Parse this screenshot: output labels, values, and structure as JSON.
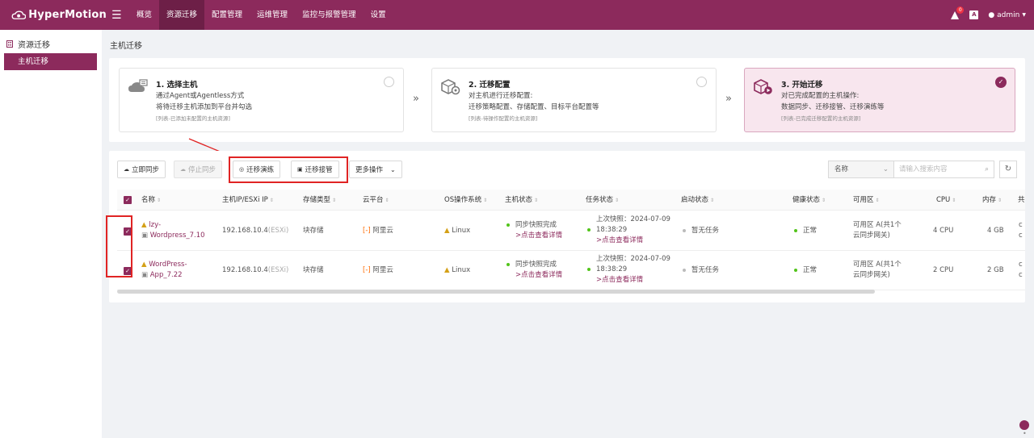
{
  "header": {
    "brand": "HyperMotion",
    "nav": [
      {
        "label": "概览"
      },
      {
        "label": "资源迁移"
      },
      {
        "label": "配置管理"
      },
      {
        "label": "运维管理"
      },
      {
        "label": "监控与报警管理"
      },
      {
        "label": "设置"
      }
    ],
    "active_nav": "资源迁移",
    "notification_count": "0",
    "lang_badge": "A",
    "user": "admin"
  },
  "sidebar": {
    "group_label": "资源迁移",
    "items": [
      {
        "label": "主机迁移"
      }
    ]
  },
  "page_title": "主机迁移",
  "steps": [
    {
      "title": "1. 选择主机",
      "desc1": "通过Agent或Agentless方式",
      "desc2": "将待迁移主机添加到平台并勾选",
      "note": "[列表-已添加未配置的主机资源]",
      "state": "pending"
    },
    {
      "title": "2. 迁移配置",
      "desc1": "对主机进行迁移配置:",
      "desc2": "迁移策略配置、存储配置、目标平台配置等",
      "note": "[列表-待操作配置的主机资源]",
      "state": "pending"
    },
    {
      "title": "3. 开始迁移",
      "desc1": "对已完成配置的主机操作:",
      "desc2": "数据同步、迁移接管、迁移演练等",
      "note": "[列表-已完成迁移配置的主机资源]",
      "state": "active"
    }
  ],
  "toolbar": {
    "sync_now": "立即同步",
    "stop_sync": "停止同步",
    "drill": "迁移演练",
    "takeover": "迁移接管",
    "more": "更多操作",
    "search_field": "名称",
    "search_placeholder": "请输入搜索内容"
  },
  "table": {
    "columns": [
      "名称",
      "主机IP/ESXi IP",
      "存储类型",
      "云平台",
      "OS操作系统",
      "主机状态",
      "任务状态",
      "启动状态",
      "健康状态",
      "可用区",
      "CPU",
      "内存",
      "共"
    ],
    "rows": [
      {
        "name_line1": "lzy-",
        "name_line2": "Wordpress_7.10",
        "ip": "192.168.10.4",
        "ip_suffix": "(ESXi)",
        "storage": "块存储",
        "cloud": "阿里云",
        "os": "Linux",
        "host_status": "同步快照完成",
        "host_link": ">点击查看详情",
        "task_line1": "上次快照：2024-07-09",
        "task_line2": "18:38:29",
        "task_link": ">点击查看详情",
        "boot_status": "暂无任务",
        "health": "正常",
        "zone_line1": "可用区 A(共1个",
        "zone_line2": "云同步网关)",
        "cpu": "4 CPU",
        "mem": "4 GB",
        "extra_line1": "c",
        "extra_line2": "c"
      },
      {
        "name_line1": "WordPress-",
        "name_line2": "App_7.22",
        "ip": "192.168.10.4",
        "ip_suffix": "(ESXi)",
        "storage": "块存储",
        "cloud": "阿里云",
        "os": "Linux",
        "host_status": "同步快照完成",
        "host_link": ">点击查看详情",
        "task_line1": "上次快照：2024-07-09",
        "task_line2": "18:38:29",
        "task_link": ">点击查看详情",
        "boot_status": "暂无任务",
        "health": "正常",
        "zone_line1": "可用区 A(共1个",
        "zone_line2": "云同步网关)",
        "cpu": "2 CPU",
        "mem": "2 GB",
        "extra_line1": "c",
        "extra_line2": "c"
      }
    ]
  },
  "colors": {
    "brand": "#8c2a5c",
    "highlight": "#e02424",
    "ok": "#52c41a"
  }
}
